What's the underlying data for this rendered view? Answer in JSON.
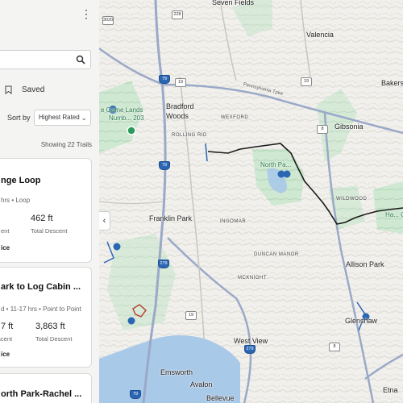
{
  "sidebar": {
    "saved_label": "Saved",
    "sort_label": "Sort by",
    "sort_value": "Highest Rated",
    "showing": "Showing 22 Trails",
    "cards": [
      {
        "title": "nge Loop",
        "meta": "hrs • Loop",
        "stat1_val": "",
        "stat1_lbl": "ent",
        "stat2_val": "462 ft",
        "stat2_lbl": "Total Descent",
        "foot": "ice"
      },
      {
        "title": "ark to Log Cabin ...",
        "meta": "d • 11-17 hrs • Point to Point",
        "stat1_val": "7 ft",
        "stat1_lbl": "ascent",
        "stat2_val": "3,863 ft",
        "stat2_lbl": "Total Descent",
        "foot": "ice"
      },
      {
        "title": "orth Park-Rachel ..."
      }
    ]
  },
  "map": {
    "labels": {
      "seven_fields": "Seven Fields",
      "valencia": "Valencia",
      "bakerstown": "Bakers",
      "game_lands": "e Game Lands",
      "number_203": "Numb... 203",
      "bradford_woods": "Bradford\nWoods",
      "wexford": "WEXFORD",
      "gibsonia": "Gibsonia",
      "rolling_rid": "ROLLING RID",
      "north_park": "North Pa...",
      "wildwood": "WILDWOOD",
      "franklin_park": "Franklin Park",
      "ingomar": "INGOMAR",
      "duncan_manor": "DUNCAN MANOR",
      "allison_park": "Allison Park",
      "mcknight": "MCKNIGHT",
      "glenshaw": "Glenshaw",
      "west_view": "West View",
      "emsworth": "Emsworth",
      "avalon": "Avalon",
      "bellevue": "Bellevue",
      "etna": "Etna",
      "hartwood": "Ha... Comm",
      "pennsylvania_tpke": "Pennsylvania Tpke"
    },
    "shields": [
      "3020",
      "228",
      "79",
      "19",
      "19",
      "8",
      "79",
      "279",
      "279",
      "8",
      "19",
      "79"
    ],
    "colors": {
      "trail": "#1a1a1a",
      "park": "#bfe3c6",
      "river": "#a9c9e8",
      "highway": "#9aa9c8",
      "accent": "#2a66b3"
    }
  }
}
